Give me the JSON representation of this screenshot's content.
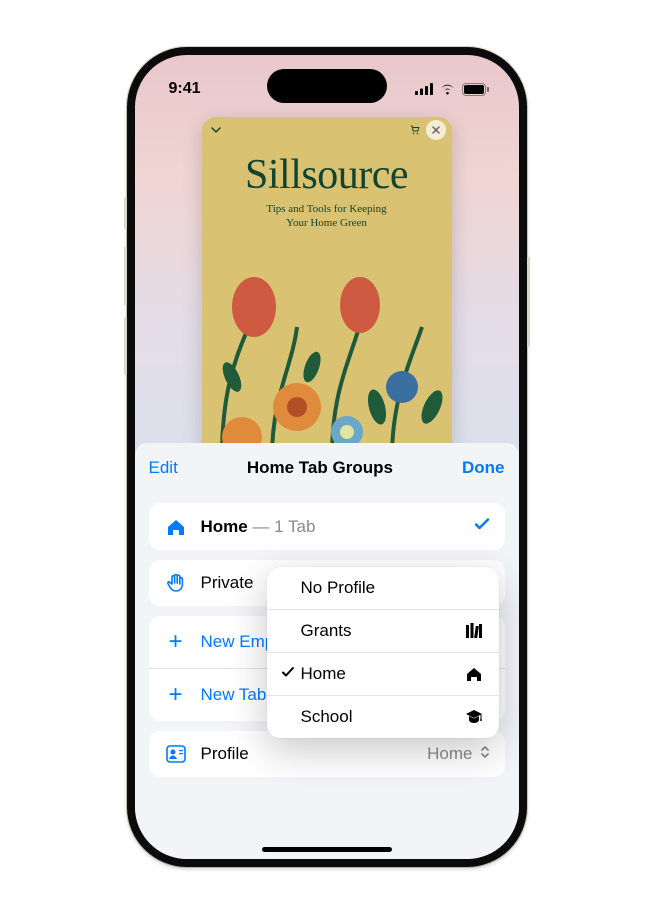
{
  "status": {
    "time": "9:41"
  },
  "card": {
    "title": "Sillsource",
    "subtitle": "Tips and Tools for Keeping\nYour Home Green"
  },
  "sheet": {
    "edit": "Edit",
    "title": "Home Tab Groups",
    "done": "Done",
    "groups": {
      "home": {
        "label": "Home",
        "suffix": " — 1 Tab"
      },
      "private": {
        "label": "Private"
      }
    },
    "actions": {
      "newEmpty": "New Empty Tab Group",
      "newFrom": "New Tab Group from This Tab"
    },
    "profile": {
      "label": "Profile",
      "value": "Home"
    }
  },
  "menu": {
    "items": [
      {
        "label": "No Profile",
        "checked": false,
        "icon": null
      },
      {
        "label": "Grants",
        "checked": false,
        "icon": "library"
      },
      {
        "label": "Home",
        "checked": true,
        "icon": "house"
      },
      {
        "label": "School",
        "checked": false,
        "icon": "gradcap"
      }
    ]
  },
  "colors": {
    "accent": "#007aff"
  }
}
